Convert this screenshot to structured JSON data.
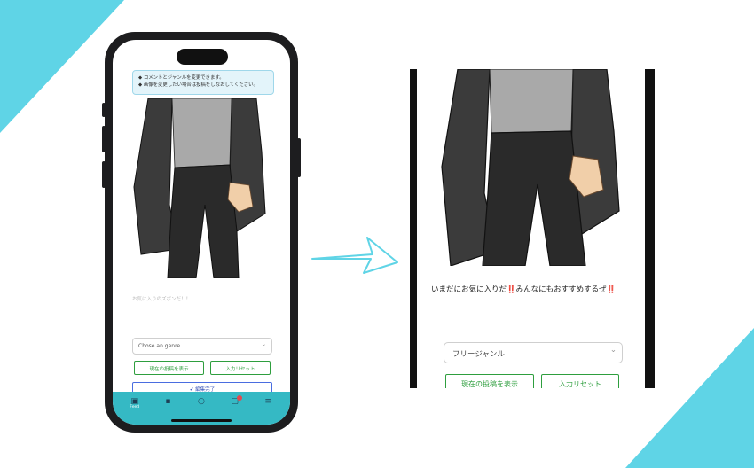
{
  "colors": {
    "accent_cyan": "#5fd4e6",
    "tabbar": "#35b9c4",
    "green_button": "#2e9e3e",
    "blue_button": "#4a6de0"
  },
  "left_phone": {
    "notice_lines": [
      "◆ コメントとジャンルを変更できます。",
      "◆ 画像を変更したい場合は投稿をしなおしてください。"
    ],
    "caption_placeholder": "お気に入りのズボンだ！！！",
    "genre_select": {
      "value": "Chose an genre"
    },
    "show_current_button": "現在の投稿を表示",
    "reset_button": "入力リセット",
    "done_button": "✔ 編集完了",
    "tabs": [
      {
        "icon": "feed-icon",
        "label": "Feed"
      },
      {
        "icon": "profile-icon",
        "label": ""
      },
      {
        "icon": "search-icon",
        "label": ""
      },
      {
        "icon": "notifications-icon",
        "label": ""
      },
      {
        "icon": "menu-icon",
        "label": ""
      }
    ]
  },
  "right_view": {
    "comment_text": "いまだにお気に入りだ‼️みんなにもおすすめするぜ‼️",
    "genre_select": {
      "value": "フリージャンル"
    },
    "show_current_button": "現在の投稿を表示",
    "reset_button": "入力リセット"
  }
}
